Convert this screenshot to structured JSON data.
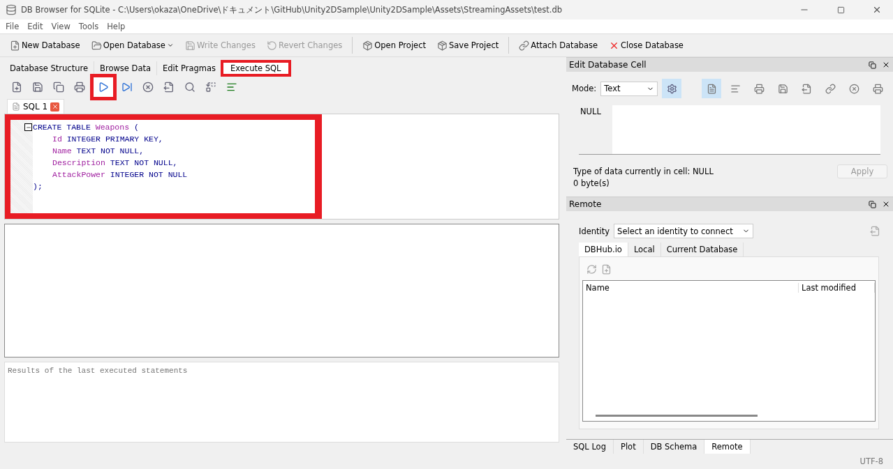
{
  "window": {
    "title": "DB Browser for SQLite - C:\\Users\\okaza\\OneDrive\\ドキュメント\\GitHub\\Unity2DSample\\Unity2DSample\\Assets\\StreamingAssets\\test.db"
  },
  "menu": [
    "File",
    "Edit",
    "View",
    "Tools",
    "Help"
  ],
  "toolbar": [
    {
      "label": "New Database",
      "disabled": false
    },
    {
      "label": "Open Database",
      "disabled": false
    },
    {
      "label": "Write Changes",
      "disabled": true
    },
    {
      "label": "Revert Changes",
      "disabled": true
    },
    {
      "label": "Open Project",
      "disabled": false
    },
    {
      "label": "Save Project",
      "disabled": false
    },
    {
      "label": "Attach Database",
      "disabled": false
    },
    {
      "label": "Close Database",
      "disabled": false
    }
  ],
  "tabs": [
    {
      "label": "Database Structure",
      "selected": false,
      "highlighted": false
    },
    {
      "label": "Browse Data",
      "selected": false,
      "highlighted": false
    },
    {
      "label": "Edit Pragmas",
      "selected": false,
      "highlighted": false
    },
    {
      "label": "Execute SQL",
      "selected": true,
      "highlighted": true
    }
  ],
  "sql_toolbar": [
    {
      "highlighted": false
    },
    {
      "highlighted": false
    },
    {
      "highlighted": false
    },
    {
      "highlighted": false
    },
    {
      "highlighted": true
    },
    {
      "highlighted": false
    },
    {
      "highlighted": false
    },
    {
      "highlighted": false
    },
    {
      "highlighted": false
    },
    {
      "highlighted": false
    },
    {
      "highlighted": false
    }
  ],
  "editor": {
    "tab": "SQL 1",
    "highlighted": true,
    "lines": [
      {
        "expanded": true,
        "tokens": [
          {
            "text": "CREATE TABLE",
            "kind": "keyword"
          },
          {
            "text": "Weapons",
            "kind": "name"
          },
          {
            "text": "(",
            "kind": "keyword"
          }
        ],
        "children": [
          {
            "tokens": [
              {
                "text": "Id",
                "kind": "name"
              },
              {
                "text": "INTEGER PRIMARY KEY,",
                "kind": "keyword"
              }
            ]
          },
          {
            "tokens": [
              {
                "text": "Name",
                "kind": "name"
              },
              {
                "text": "TEXT NOT NULL,",
                "kind": "keyword"
              }
            ]
          },
          {
            "tokens": [
              {
                "text": "Description",
                "kind": "name"
              },
              {
                "text": "TEXT NOT NULL,",
                "kind": "keyword"
              }
            ]
          },
          {
            "tokens": [
              {
                "text": "AttackPower",
                "kind": "name"
              },
              {
                "text": "INTEGER NOT NULL",
                "kind": "keyword"
              }
            ]
          }
        ]
      },
      {
        "tokens": [
          {
            "text": ");",
            "kind": "keyword"
          }
        ]
      }
    ]
  },
  "results": {
    "message_placeholder": "Results of the last executed statements"
  },
  "edit_cell": {
    "title": "Edit Database Cell",
    "mode_label": "Mode:",
    "mode": "Text",
    "value": "NULL",
    "type_info": "Type of data currently in cell: NULL",
    "size": "0 byte(s)",
    "apply": "Apply",
    "apply_disabled": true
  },
  "remote": {
    "title": "Remote",
    "identity_label": "Identity",
    "identity": "Select an identity to connect",
    "tabs": [
      {
        "label": "DBHub.io",
        "selected": true
      },
      {
        "label": "Local",
        "selected": false
      },
      {
        "label": "Current Database",
        "selected": false
      }
    ],
    "columns": [
      "Name",
      "Last modified"
    ]
  },
  "dock_tabs": [
    {
      "label": "SQL Log",
      "selected": false
    },
    {
      "label": "Plot",
      "selected": false
    },
    {
      "label": "DB Schema",
      "selected": false
    },
    {
      "label": "Remote",
      "selected": true
    }
  ],
  "status_bar": {
    "encoding": "UTF-8"
  }
}
